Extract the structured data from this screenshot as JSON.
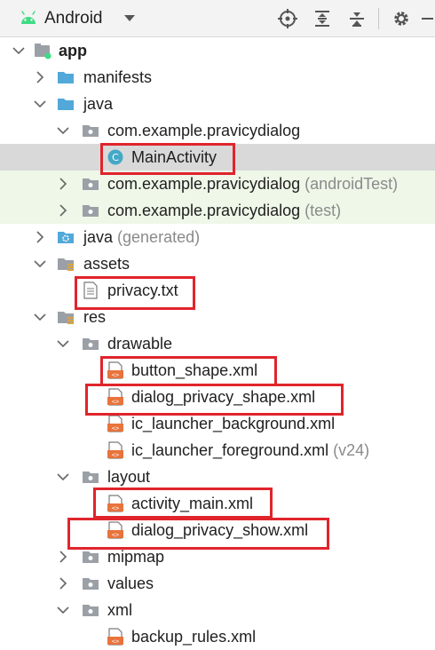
{
  "toolbar": {
    "view_title": "Android",
    "icons": [
      "android-icon",
      "dropdown-chevron-icon",
      "locate-icon",
      "expand-all-icon",
      "collapse-all-icon",
      "gear-icon",
      "hide-icon"
    ]
  },
  "colors": {
    "highlight_box": "#e0242c",
    "folder": "#9aa0a6",
    "java_folder": "#52a8d8",
    "xml_file": "#e8733c",
    "class_icon": "#45a8c7",
    "selected_row": "#d9d9d9",
    "test_row": "#eef7e8"
  },
  "tree": {
    "rows": [
      {
        "label": "app",
        "suffix": "",
        "icon": "module-icon",
        "arrow": "down"
      },
      {
        "label": "manifests",
        "suffix": "",
        "icon": "folder-icon",
        "arrow": "right"
      },
      {
        "label": "java",
        "suffix": "",
        "icon": "folder-icon",
        "arrow": "down"
      },
      {
        "label": "com.example.pravicydialog",
        "suffix": "",
        "icon": "package-icon",
        "arrow": "down"
      },
      {
        "label": "MainActivity",
        "suffix": "",
        "icon": "class-icon",
        "arrow": "none"
      },
      {
        "label": "com.example.pravicydialog",
        "suffix": "(androidTest)",
        "icon": "package-icon",
        "arrow": "right"
      },
      {
        "label": "com.example.pravicydialog",
        "suffix": "(test)",
        "icon": "package-icon",
        "arrow": "right"
      },
      {
        "label": "java",
        "suffix": "(generated)",
        "icon": "generated-folder-icon",
        "arrow": "right"
      },
      {
        "label": "assets",
        "suffix": "",
        "icon": "resource-folder-icon",
        "arrow": "down"
      },
      {
        "label": "privacy.txt",
        "suffix": "",
        "icon": "text-file-icon",
        "arrow": "none"
      },
      {
        "label": "res",
        "suffix": "",
        "icon": "resource-folder-icon",
        "arrow": "down"
      },
      {
        "label": "drawable",
        "suffix": "",
        "icon": "package-icon",
        "arrow": "down"
      },
      {
        "label": "button_shape.xml",
        "suffix": "",
        "icon": "xml-file-icon",
        "arrow": "none"
      },
      {
        "label": "dialog_privacy_shape.xml",
        "suffix": "",
        "icon": "xml-file-icon",
        "arrow": "none"
      },
      {
        "label": "ic_launcher_background.xml",
        "suffix": "",
        "icon": "xml-file-icon",
        "arrow": "none"
      },
      {
        "label": "ic_launcher_foreground.xml",
        "suffix": "(v24)",
        "icon": "xml-file-icon",
        "arrow": "none"
      },
      {
        "label": "layout",
        "suffix": "",
        "icon": "package-icon",
        "arrow": "down"
      },
      {
        "label": "activity_main.xml",
        "suffix": "",
        "icon": "xml-file-icon",
        "arrow": "none"
      },
      {
        "label": "dialog_privacy_show.xml",
        "suffix": "",
        "icon": "xml-file-icon",
        "arrow": "none"
      },
      {
        "label": "mipmap",
        "suffix": "",
        "icon": "package-icon",
        "arrow": "right"
      },
      {
        "label": "values",
        "suffix": "",
        "icon": "package-icon",
        "arrow": "right"
      },
      {
        "label": "xml",
        "suffix": "",
        "icon": "package-icon",
        "arrow": "down"
      },
      {
        "label": "backup_rules.xml",
        "suffix": "",
        "icon": "xml-file-icon",
        "arrow": "none"
      }
    ]
  }
}
